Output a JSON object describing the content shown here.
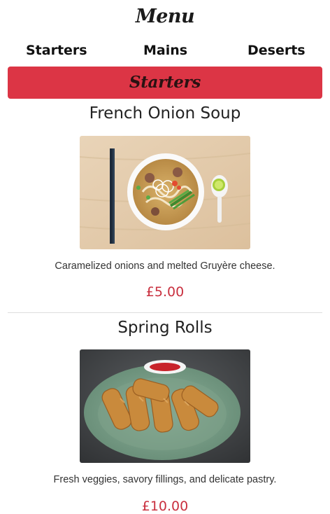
{
  "header": {
    "title": "Menu"
  },
  "nav": {
    "items": [
      {
        "label": "Starters"
      },
      {
        "label": "Mains"
      },
      {
        "label": "Deserts"
      }
    ]
  },
  "section": {
    "title": "Starters"
  },
  "items": [
    {
      "name": "French Onion Soup",
      "description": "Caramelized onions and melted Gruyère cheese.",
      "price": "£5.00",
      "image_icon": "soup-bowl-photo"
    },
    {
      "name": "Spring Rolls",
      "description": "Fresh veggies, savory fillings, and delicate pastry.",
      "price": "£10.00",
      "image_icon": "spring-rolls-photo"
    }
  ],
  "colors": {
    "accent": "#dc3545",
    "price": "#c9303f"
  }
}
